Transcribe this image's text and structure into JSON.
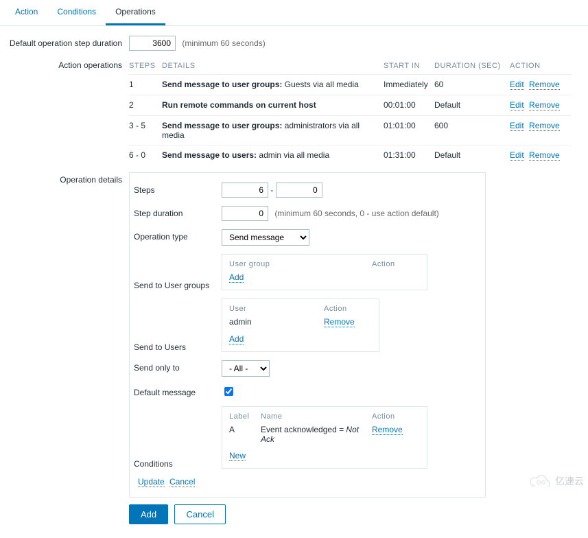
{
  "tabs": {
    "action": "Action",
    "conditions": "Conditions",
    "operations": "Operations"
  },
  "labels": {
    "default_step_duration": "Default operation step duration",
    "min_60": "(minimum 60 seconds)",
    "action_operations": "Action operations",
    "operation_details": "Operation details",
    "steps": "Steps",
    "step_duration": "Step duration",
    "step_duration_hint": "(minimum 60 seconds, 0 - use action default)",
    "operation_type": "Operation type",
    "send_to_user_groups": "Send to User groups",
    "send_to_users": "Send to Users",
    "send_only_to": "Send only to",
    "default_message": "Default message",
    "conditions": "Conditions",
    "add": "Add",
    "new": "New",
    "update": "Update",
    "cancel": "Cancel",
    "add_btn": "Add",
    "cancel_btn": "Cancel",
    "dash": "-"
  },
  "step_duration_value": "3600",
  "ops_headers": {
    "steps": "Steps",
    "details": "Details",
    "start_in": "Start in",
    "duration": "Duration (sec)",
    "action": "Action"
  },
  "ops_links": {
    "edit": "Edit",
    "remove": "Remove"
  },
  "operations": [
    {
      "steps": "1",
      "bold": "Send message to user groups:",
      "rest": " Guests via all media",
      "start": "Immediately",
      "duration": "60"
    },
    {
      "steps": "2",
      "bold": "Run remote commands on current host",
      "rest": "",
      "start": "00:01:00",
      "duration": "Default"
    },
    {
      "steps": "3 - 5",
      "bold": "Send message to user groups:",
      "rest": " administrators via all media",
      "start": "01:01:00",
      "duration": "600"
    },
    {
      "steps": "6 - 0",
      "bold": "Send message to users:",
      "rest": " admin via all media",
      "start": "01:31:00",
      "duration": "Default"
    }
  ],
  "details": {
    "step_from": "6",
    "step_to": "0",
    "step_duration": "0",
    "operation_type": "Send message",
    "send_only_to": "- All -",
    "default_message_checked": true
  },
  "user_group_box": {
    "h1": "User group",
    "h2": "Action"
  },
  "user_box": {
    "h1": "User",
    "h2": "Action",
    "user": "admin",
    "remove": "Remove"
  },
  "cond_box": {
    "h_label": "Label",
    "h_name": "Name",
    "h_action": "Action",
    "label": "A",
    "name_pre": "Event acknowledged = ",
    "name_val": "Not Ack",
    "remove": "Remove"
  },
  "watermark": "亿速云"
}
